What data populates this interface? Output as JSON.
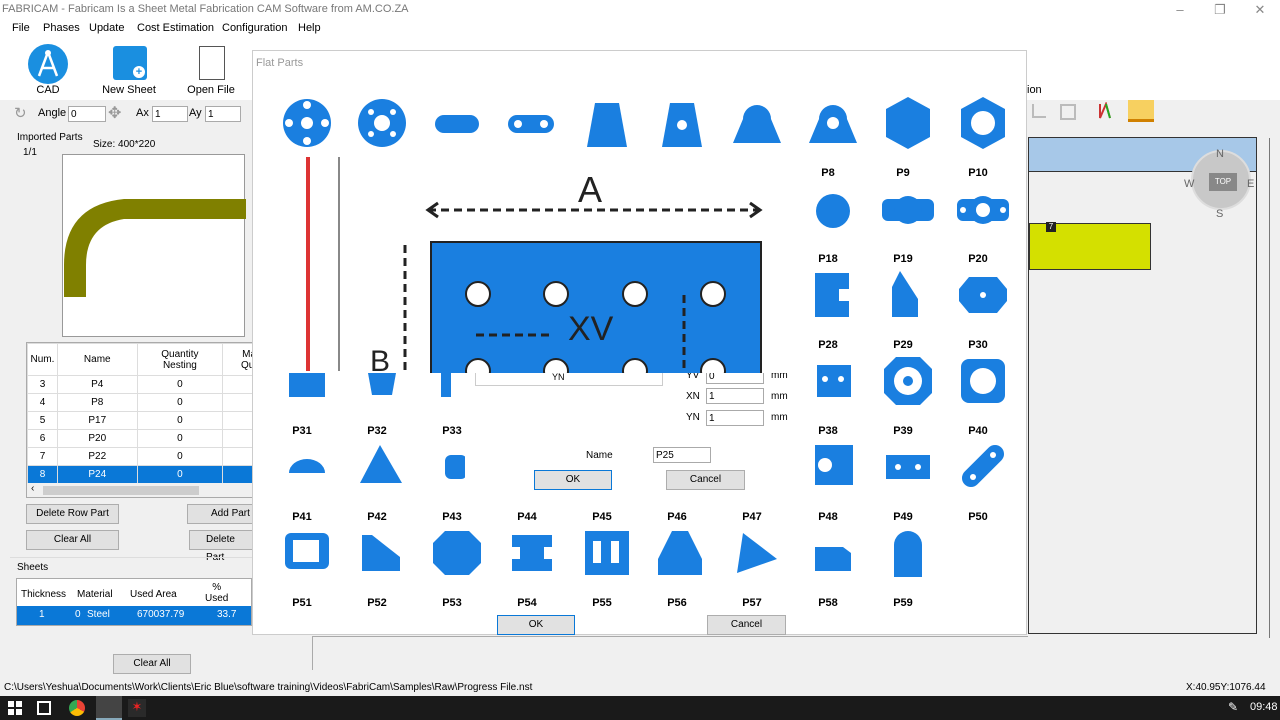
{
  "window": {
    "title": "FABRICAM - Fabricam Is a Sheet Metal Fabrication CAM Software from AM.CO.ZA",
    "min": "–",
    "max": "❐",
    "close": "✕"
  },
  "menu": [
    "File",
    "Phases",
    "Update",
    "Cost Estimation",
    "Configuration",
    "Help"
  ],
  "toolbar": {
    "cad": "CAD",
    "new_sheet": "New Sheet",
    "open_file": "Open File",
    "angle_label": "Angle",
    "angle_value": "0",
    "ax_label": "Ax",
    "ax_value": "1",
    "ay_label": "Ay",
    "ay_value": "1",
    "right_label": "ion"
  },
  "imported": {
    "title": "Imported Parts",
    "page": "1/1",
    "size": "Size: 400*220"
  },
  "parts_table": {
    "headers": [
      "Num.",
      "Name",
      "Quantity\nNesting",
      "Manu\nQuant"
    ],
    "rows": [
      {
        "num": "3",
        "name": "P4",
        "qty": "0"
      },
      {
        "num": "4",
        "name": "P8",
        "qty": "0"
      },
      {
        "num": "5",
        "name": "P17",
        "qty": "0"
      },
      {
        "num": "6",
        "name": "P20",
        "qty": "0"
      },
      {
        "num": "7",
        "name": "P22",
        "qty": "0"
      },
      {
        "num": "8",
        "name": "P24",
        "qty": "0"
      }
    ]
  },
  "buttons": {
    "delete_row_part": "Delete Row Part",
    "add_part": "Add Part",
    "clear_all": "Clear All",
    "delete_part": "Delete Part",
    "clear_all_sheets": "Clear All"
  },
  "sheets": {
    "title": "Sheets",
    "headers": [
      "Thickness",
      "Material",
      "Used Area",
      "%\nUsed"
    ],
    "row": {
      "thickness": "1",
      "mat_id": "0",
      "material": "Steel",
      "used_area": "670037.79",
      "used": "33.7"
    }
  },
  "compass": {
    "n": "N",
    "s": "S",
    "e": "E",
    "w": "W",
    "top": "TOP"
  },
  "canvas_marker": "7",
  "flat_parts": {
    "title": "Flat Parts",
    "ok": "OK",
    "cancel": "Cancel",
    "labels_row1": [
      "P8",
      "P9",
      "P10"
    ],
    "labels_row2": [
      "P18",
      "P19",
      "P20"
    ],
    "labels_row3": [
      "P28",
      "P29",
      "P30"
    ],
    "labels_row4": [
      "P31",
      "P32",
      "P33",
      "P38",
      "P39",
      "P40"
    ],
    "labels_row5": [
      "P41",
      "P42",
      "P43",
      "P44",
      "P45",
      "P46",
      "P47",
      "P48",
      "P49",
      "P50"
    ],
    "labels_row6": [
      "P51",
      "P52",
      "P53",
      "P54",
      "P55",
      "P56",
      "P57",
      "P58",
      "P59"
    ]
  },
  "sub_dialog": {
    "yv_label": "YV",
    "yv_value": "0",
    "xn_label": "XN",
    "xn_value": "1",
    "yn_label": "YN",
    "yn_value": "1",
    "unit": "mm",
    "name_label": "Name",
    "name_value": "P25",
    "ok": "OK",
    "cancel": "Cancel",
    "yn_tag": "YN"
  },
  "zoom_preview": {
    "a": "A",
    "b": "B",
    "xv": "XV"
  },
  "status": {
    "path": "C:\\Users\\Yeshua\\Documents\\Work\\Clients\\Eric Blue\\software training\\Videos\\FabriCam\\Samples\\Raw\\Progress File.nst",
    "coords": "X:40.95Y:1076.44"
  },
  "taskbar": {
    "time": "09:48"
  },
  "colors": {
    "part_blue": "#1a7fe0",
    "olive": "#808000",
    "yellow": "#d4e000",
    "select": "#0a78d7"
  }
}
